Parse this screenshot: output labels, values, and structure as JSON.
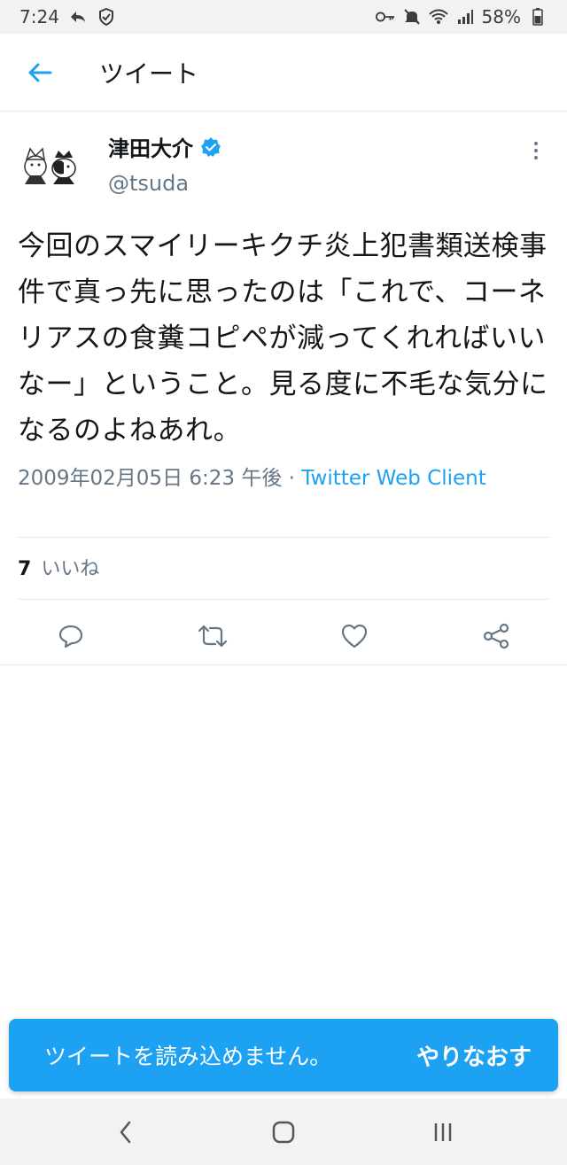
{
  "status_bar": {
    "time": "7:24",
    "battery": "58%"
  },
  "header": {
    "title": "ツイート"
  },
  "tweet": {
    "author_name": "津田大介",
    "author_handle": "@tsuda",
    "text": "今回のスマイリーキクチ炎上犯書類送検事件で真っ先に思ったのは「これで、コーネリアスの食糞コピペが減ってくれればいいなー」ということ。見る度に不毛な気分になるのよねあれ。",
    "timestamp": "2009年02月05日 6:23 午後",
    "separator": "·",
    "client": "Twitter Web Client",
    "like_count": "7",
    "like_label": "いいね"
  },
  "toast": {
    "message": "ツイートを読み込めません。",
    "action": "やりなおす"
  },
  "colors": {
    "accent": "#1da1f2",
    "secondary_text": "#657786",
    "primary_text": "#14171a"
  }
}
